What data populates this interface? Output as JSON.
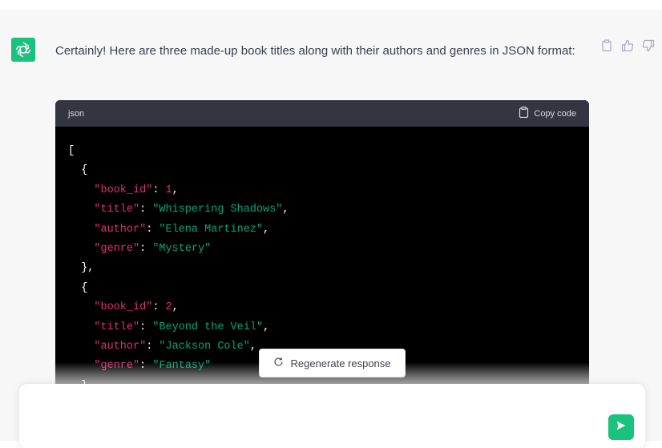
{
  "message": {
    "text": "Certainly! Here are three made-up book titles along with their authors and genres in JSON format:"
  },
  "code": {
    "language": "json",
    "copy_label": "Copy code",
    "lines": [
      [
        [
          "p",
          "["
        ]
      ],
      [
        [
          "p",
          "  {"
        ]
      ],
      [
        [
          "p",
          "    "
        ],
        [
          "k",
          "\"book_id\""
        ],
        [
          "p",
          ": "
        ],
        [
          "n",
          "1"
        ],
        [
          "p",
          ","
        ]
      ],
      [
        [
          "p",
          "    "
        ],
        [
          "k",
          "\"title\""
        ],
        [
          "p",
          ": "
        ],
        [
          "s",
          "\"Whispering Shadows\""
        ],
        [
          "p",
          ","
        ]
      ],
      [
        [
          "p",
          "    "
        ],
        [
          "k",
          "\"author\""
        ],
        [
          "p",
          ": "
        ],
        [
          "s",
          "\"Elena Martinez\""
        ],
        [
          "p",
          ","
        ]
      ],
      [
        [
          "p",
          "    "
        ],
        [
          "k",
          "\"genre\""
        ],
        [
          "p",
          ": "
        ],
        [
          "s",
          "\"Mystery\""
        ]
      ],
      [
        [
          "p",
          "  },"
        ]
      ],
      [
        [
          "p",
          "  {"
        ]
      ],
      [
        [
          "p",
          "    "
        ],
        [
          "k",
          "\"book_id\""
        ],
        [
          "p",
          ": "
        ],
        [
          "n",
          "2"
        ],
        [
          "p",
          ","
        ]
      ],
      [
        [
          "p",
          "    "
        ],
        [
          "k",
          "\"title\""
        ],
        [
          "p",
          ": "
        ],
        [
          "s",
          "\"Beyond the Veil\""
        ],
        [
          "p",
          ","
        ]
      ],
      [
        [
          "p",
          "    "
        ],
        [
          "k",
          "\"author\""
        ],
        [
          "p",
          ": "
        ],
        [
          "s",
          "\"Jackson Cole\""
        ],
        [
          "p",
          ","
        ]
      ],
      [
        [
          "p",
          "    "
        ],
        [
          "k",
          "\"genre\""
        ],
        [
          "p",
          ": "
        ],
        [
          "s",
          "\"Fantasy\""
        ]
      ],
      [
        [
          "p",
          "  }"
        ]
      ]
    ]
  },
  "regenerate_label": "Regenerate response",
  "composer": {
    "placeholder": ""
  },
  "icons": {
    "avatar": "openai-logo-icon",
    "copy": "clipboard-icon",
    "like": "thumbs-up-icon",
    "dislike": "thumbs-down-icon",
    "regenerate": "refresh-icon",
    "send": "send-icon"
  },
  "colors": {
    "accent": "#19c37d",
    "code_bg": "#000000",
    "code_header": "#343541",
    "json_key": "#df3079",
    "json_string": "#00a67d"
  }
}
